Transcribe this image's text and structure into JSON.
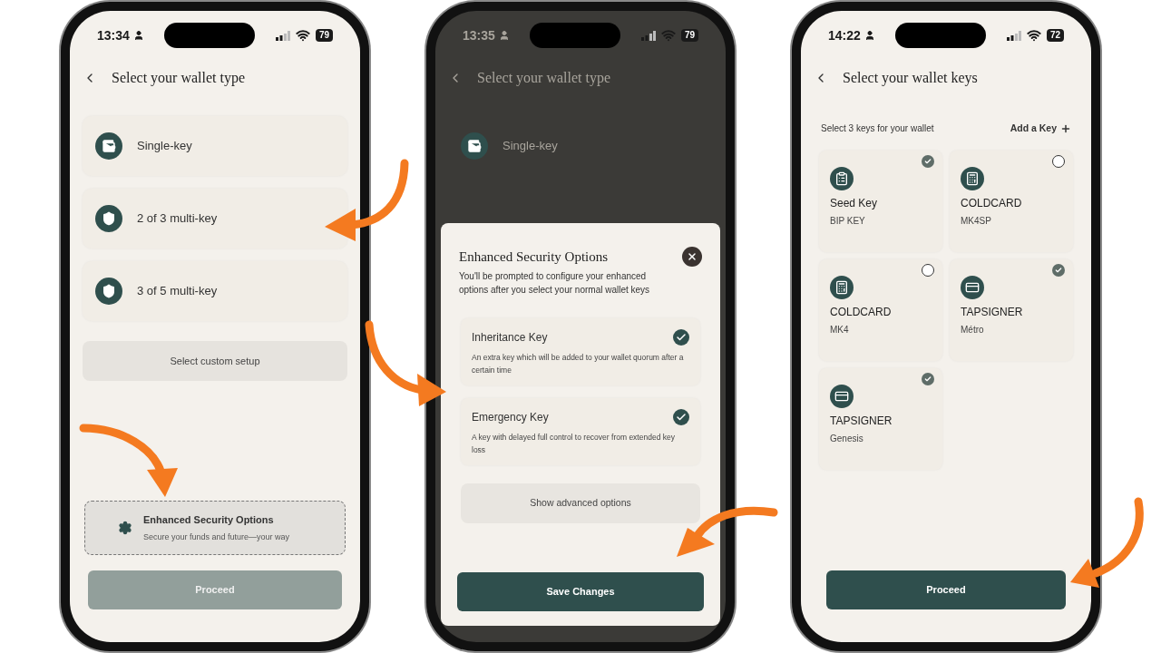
{
  "screens": [
    {
      "kind": "wallet_type",
      "status": {
        "time": "13:34",
        "battery": "79"
      },
      "title": "Select your wallet type",
      "options": [
        {
          "kind": "wallet",
          "label": "Single-key"
        },
        {
          "kind": "shield",
          "label": "2 of 3 multi-key"
        },
        {
          "kind": "shield_lock",
          "label": "3 of 5 multi-key"
        }
      ],
      "custom_button": "Select custom setup",
      "enhanced": {
        "title": "Enhanced Security Options",
        "subtitle": "Secure your funds and future—your way"
      },
      "proceed": {
        "label": "Proceed",
        "disabled": true
      }
    },
    {
      "kind": "security_sheet",
      "status": {
        "time": "13:35",
        "battery": "79"
      },
      "title": "Select your wallet type",
      "options": [
        {
          "kind": "wallet",
          "label": "Single-key"
        }
      ],
      "sheet": {
        "title": "Enhanced Security Options",
        "description": "You'll be prompted to configure your enhanced options after you select your normal wallet keys",
        "options": [
          {
            "title": "Inheritance Key",
            "description": "An extra key which will be added to your wallet quorum after a certain time",
            "checked": true
          },
          {
            "title": "Emergency Key",
            "description": "A key with delayed full control to recover from extended key loss",
            "checked": true
          }
        ],
        "advanced_button": "Show advanced options",
        "save_button": "Save Changes"
      }
    },
    {
      "kind": "keys",
      "status": {
        "time": "14:22",
        "battery": "72"
      },
      "title": "Select your wallet keys",
      "hint": "Select 3 keys for your wallet",
      "add_key": "Add a Key",
      "keys": [
        {
          "kind": "seed",
          "name": "Seed Key",
          "type": "BIP KEY",
          "checked": true
        },
        {
          "kind": "coldcard",
          "name": "COLDCARD",
          "type": "MK4SP",
          "checked": false
        },
        {
          "kind": "coldcard",
          "name": "COLDCARD",
          "type": "MK4",
          "checked": false
        },
        {
          "kind": "tapsigner",
          "name": "TAPSIGNER",
          "type": "Métro",
          "checked": true
        },
        {
          "kind": "tapsigner",
          "name": "TAPSIGNER",
          "type": "Genesis",
          "checked": true
        }
      ],
      "proceed": {
        "label": "Proceed",
        "disabled": false
      }
    }
  ]
}
